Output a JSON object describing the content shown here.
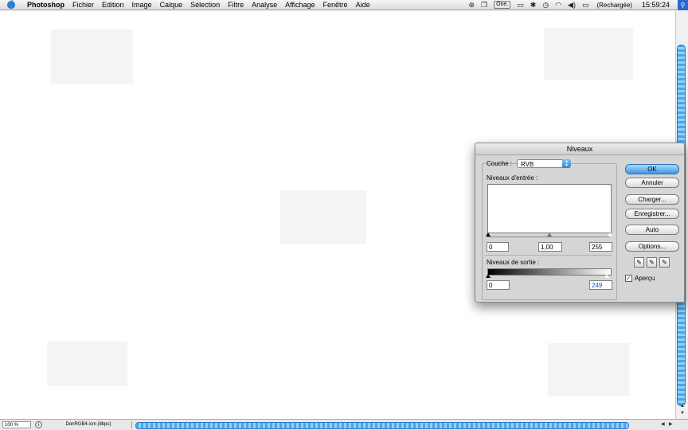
{
  "menubar": {
    "app_name": "Photoshop",
    "items": [
      "Fichier",
      "Edition",
      "Image",
      "Calque",
      "Sélection",
      "Filtre",
      "Analyse",
      "Affichage",
      "Fenêtre",
      "Aide"
    ],
    "status_box": "One.",
    "battery": "(Rechargée)",
    "clock": "15:59:24"
  },
  "statusbar": {
    "zoom": "100 %",
    "doc_info": "DonRGB4.icm (8bpc)"
  },
  "dialog": {
    "title": "Niveaux",
    "channel_label": "Couche :",
    "channel_value": "RVB",
    "input_label": "Niveaux d'entrée :",
    "input_black": "0",
    "input_gamma": "1,00",
    "input_white": "255",
    "output_label": "Niveaux de sortie :",
    "output_black": "0",
    "output_white": "249",
    "buttons": {
      "ok": "OK",
      "cancel": "Annuler",
      "load": "Charger...",
      "save": "Enregistrer...",
      "auto": "Auto",
      "options": "Options..."
    },
    "preview_label": "Aperçu",
    "preview_checked": true
  }
}
